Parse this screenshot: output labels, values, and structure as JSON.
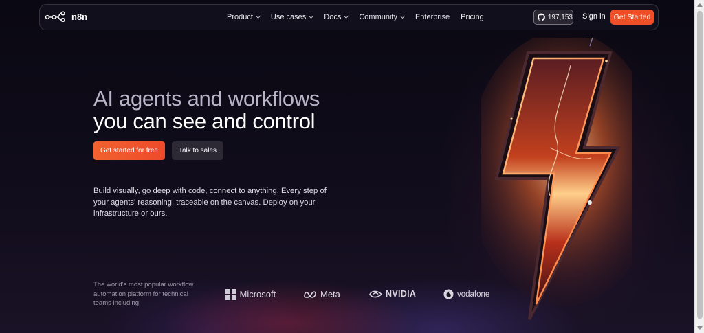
{
  "nav": {
    "logo_text": "n8n",
    "menu": [
      {
        "label": "Product",
        "has_dropdown": true
      },
      {
        "label": "Use cases",
        "has_dropdown": true
      },
      {
        "label": "Docs",
        "has_dropdown": true
      },
      {
        "label": "Community",
        "has_dropdown": true
      },
      {
        "label": "Enterprise",
        "has_dropdown": false
      },
      {
        "label": "Pricing",
        "has_dropdown": false
      }
    ],
    "github_stars": "197,153",
    "github_icon": "github-icon",
    "signin_label": "Sign in",
    "cta_label": "Get Started"
  },
  "hero": {
    "headline_line1": "AI agents and workflows",
    "headline_line2": "you can see and control",
    "primary_cta": "Get started for free",
    "secondary_cta": "Talk to sales",
    "description": "Build visually, go deep with code, connect to anything. Every step of your agents' reasoning, traceable on the canvas. Deploy on your infrastructure or ours."
  },
  "social_proof": {
    "tagline": "The world's most popular workflow automation platform for technical teams including",
    "brands": [
      "Microsoft",
      "Meta",
      "NVIDIA",
      "vodafone"
    ]
  },
  "colors": {
    "accent": "#ee4f27",
    "background": "#0e0b16"
  }
}
